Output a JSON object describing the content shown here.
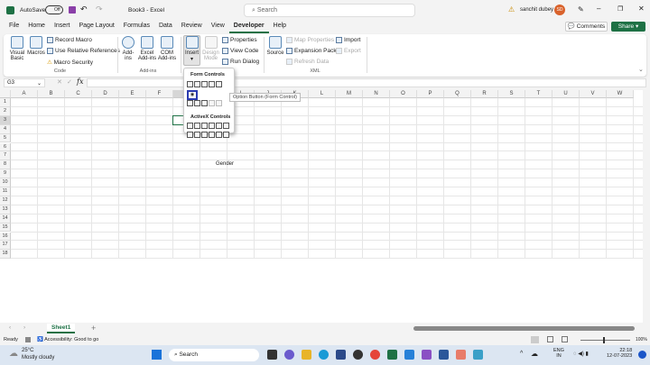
{
  "title": {
    "autosave": "AutoSave",
    "toggle": "Off",
    "doc": "Book3 - Excel",
    "search": "Search",
    "user": "sanchit dubey",
    "initials": "SD"
  },
  "tabs": [
    "File",
    "Home",
    "Insert",
    "Page Layout",
    "Formulas",
    "Data",
    "Review",
    "View",
    "Developer",
    "Help"
  ],
  "actions": {
    "comments": "Comments",
    "share": "Share"
  },
  "ribbon": {
    "code": {
      "visual_basic": "Visual Basic",
      "macros": "Macros",
      "record": "Record Macro",
      "relative": "Use Relative References",
      "security": "Macro Security",
      "label": "Code"
    },
    "addins": {
      "addins": "Add-ins",
      "excel": "Excel Add-ins",
      "com": "COM Add-ins",
      "label": "Add-ins"
    },
    "controls": {
      "insert": "Insert",
      "design": "Design Mode",
      "properties": "Properties",
      "view_code": "View Code",
      "run_dialog": "Run Dialog"
    },
    "xml": {
      "source": "Source",
      "map": "Map Properties",
      "expansion": "Expansion Packs",
      "refresh": "Refresh Data",
      "import": "Import",
      "export": "Export",
      "label": "XML"
    }
  },
  "namebox": "G3",
  "popup": {
    "form": "Form Controls",
    "activex": "ActiveX Controls",
    "tooltip": "Option Button (Form Control)"
  },
  "columns": [
    "A",
    "B",
    "C",
    "D",
    "E",
    "F",
    "G",
    "H",
    "I",
    "J",
    "K",
    "L",
    "M",
    "N",
    "O",
    "P",
    "Q",
    "R",
    "S",
    "T",
    "U",
    "V",
    "W"
  ],
  "rows": [
    "1",
    "2",
    "3",
    "4",
    "5",
    "6",
    "7",
    "8",
    "9",
    "10",
    "11",
    "12",
    "13",
    "14",
    "15",
    "16",
    "17",
    "18"
  ],
  "cells": {
    "H8": "Gender"
  },
  "sheet": "Sheet1",
  "status": {
    "ready": "Ready",
    "accessibility": "Accessibility: Good to go",
    "zoom": "100%"
  },
  "taskbar": {
    "temp": "25°C",
    "weather": "Mostly cloudy",
    "search": "Search",
    "lang": "ENG",
    "region": "IN",
    "time": "22:18",
    "date": "12-07-2023"
  }
}
